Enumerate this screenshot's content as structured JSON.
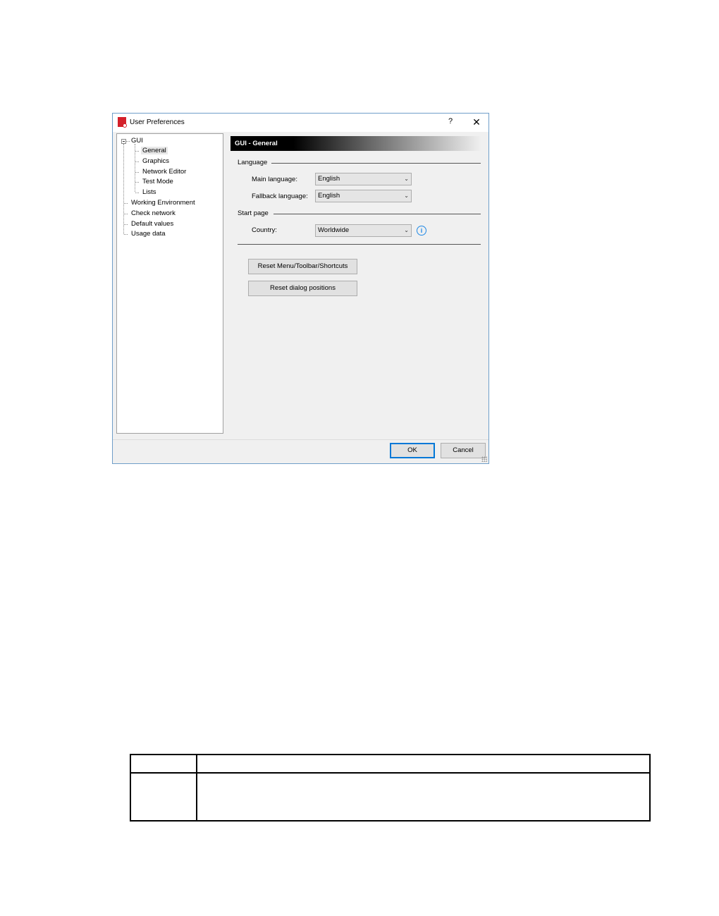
{
  "dialog": {
    "title": "User Preferences",
    "help": "?",
    "close": "✕"
  },
  "tree": {
    "items": [
      {
        "label": "GUI"
      },
      {
        "label": "General"
      },
      {
        "label": "Graphics"
      },
      {
        "label": "Network Editor"
      },
      {
        "label": "Test Mode"
      },
      {
        "label": "Lists"
      },
      {
        "label": "Working Environment"
      },
      {
        "label": "Check network"
      },
      {
        "label": "Default values"
      },
      {
        "label": "Usage data"
      }
    ]
  },
  "panel": {
    "header": "GUI - General",
    "language_group": "Language",
    "main_language_label": "Main language:",
    "main_language_value": "English",
    "fallback_language_label": "Fallback language:",
    "fallback_language_value": "English",
    "start_page_group": "Start page",
    "country_label": "Country:",
    "country_value": "Worldwide",
    "info_icon": "i",
    "reset_menu_button": "Reset Menu/Toolbar/Shortcuts",
    "reset_dialog_button": "Reset dialog positions"
  },
  "footer": {
    "ok": "OK",
    "cancel": "Cancel"
  },
  "doc_table": {
    "header": [
      "",
      ""
    ],
    "rows": [
      [
        "",
        ""
      ]
    ]
  },
  "colors": {
    "accent": "#0078d7",
    "info": "#1e88e5",
    "brand": "#d4202a"
  }
}
